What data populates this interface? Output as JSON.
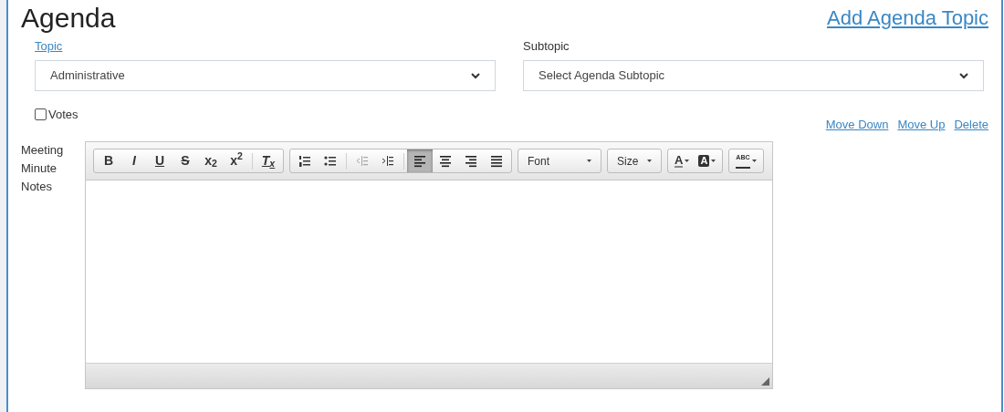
{
  "header": {
    "title": "Agenda",
    "add_link": "Add Agenda Topic"
  },
  "topic": {
    "label": "Topic",
    "value": "Administrative"
  },
  "subtopic": {
    "label": "Subtopic",
    "value": "Select Agenda Subtopic"
  },
  "votes": {
    "label": "Votes",
    "checked": false
  },
  "actions": [
    "Move Down",
    "Move Up",
    "Delete"
  ],
  "notes_label": "Meeting Minute Notes",
  "toolbar": [
    [
      {
        "kind": "bold",
        "label": "B",
        "selected": false,
        "disabled": false
      },
      {
        "kind": "italic",
        "label": "I",
        "selected": false,
        "disabled": false
      },
      {
        "kind": "underline",
        "label": "U",
        "selected": false,
        "disabled": false
      },
      {
        "kind": "strike",
        "label": "S",
        "selected": false,
        "disabled": false
      },
      {
        "kind": "script",
        "label": "x$_{2}$",
        "selected": false,
        "disabled": false
      },
      {
        "kind": "script",
        "label": "x$^{2}$",
        "selected": false,
        "disabled": false
      },
      {
        "kind": "sep"
      },
      {
        "kind": "clear",
        "label": "T$_{x}$",
        "selected": false,
        "disabled": false
      }
    ],
    [
      {
        "kind": "numbered",
        "selected": false,
        "disabled": false
      },
      {
        "kind": "bulleted",
        "selected": false,
        "disabled": false
      },
      {
        "kind": "sep"
      },
      {
        "kind": "outdent",
        "selected": false,
        "disabled": true
      },
      {
        "kind": "indent",
        "selected": false,
        "disabled": false
      },
      {
        "kind": "sep"
      },
      {
        "kind": "align-left",
        "selected": true,
        "disabled": false
      },
      {
        "kind": "align-center",
        "selected": false,
        "disabled": false
      },
      {
        "kind": "align-right",
        "selected": false,
        "disabled": false
      },
      {
        "kind": "justify",
        "selected": false,
        "disabled": false
      }
    ],
    [
      {
        "kind": "combo",
        "label": "Font"
      }
    ],
    [
      {
        "kind": "combo",
        "label": "Size"
      }
    ],
    [
      {
        "kind": "text-color",
        "label": "A"
      },
      {
        "kind": "bg-color",
        "label": "A"
      }
    ],
    [
      {
        "kind": "spell",
        "label": "ABC"
      }
    ]
  ]
}
